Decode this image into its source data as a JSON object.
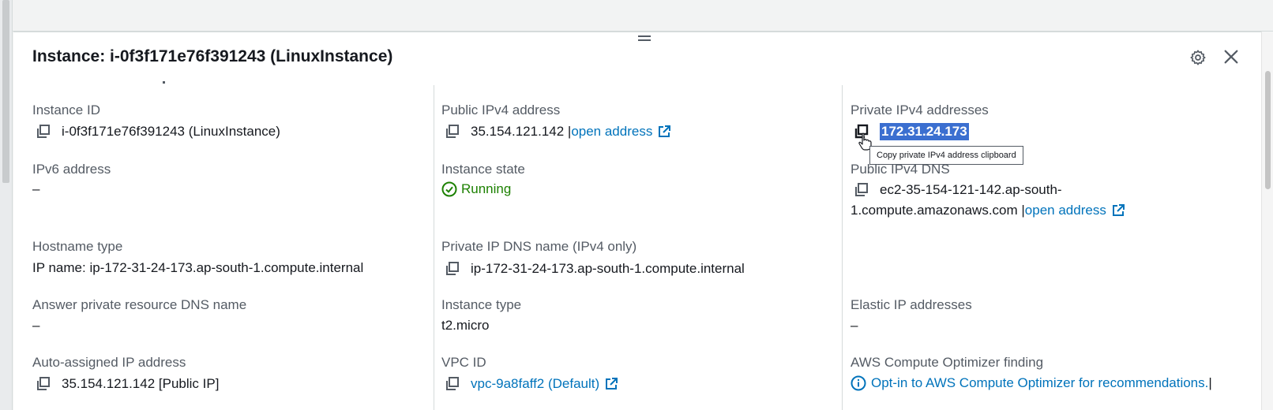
{
  "panel": {
    "title": "Instance: i-0f3f171e76f391243 (LinuxInstance)",
    "settings_icon": "gear-icon",
    "close_icon": "close-icon"
  },
  "tooltip": "Copy private IPv4 address clipboard",
  "fields": {
    "instance_id": {
      "label": "Instance ID",
      "value": "i-0f3f171e76f391243 (LinuxInstance)"
    },
    "public_ipv4": {
      "label": "Public IPv4 address",
      "value": "35.154.121.142 |",
      "link": "open address"
    },
    "private_ipv4": {
      "label": "Private IPv4 addresses",
      "value": "172.31.24.173"
    },
    "ipv6": {
      "label": "IPv6 address",
      "value": "–"
    },
    "instance_state": {
      "label": "Instance state",
      "value": "Running"
    },
    "public_dns": {
      "label": "Public IPv4 DNS",
      "value_line1": "ec2-35-154-121-142.ap-south-",
      "value_line2": "1.compute.amazonaws.com |",
      "link": "open address"
    },
    "hostname_type": {
      "label": "Hostname type",
      "value": "IP name: ip-172-31-24-173.ap-south-1.compute.internal"
    },
    "private_dns": {
      "label": "Private IP DNS name (IPv4 only)",
      "value": "ip-172-31-24-173.ap-south-1.compute.internal"
    },
    "answer_dns": {
      "label": "Answer private resource DNS name",
      "value": "–"
    },
    "instance_type": {
      "label": "Instance type",
      "value": "t2.micro"
    },
    "elastic_ip": {
      "label": "Elastic IP addresses",
      "value": "–"
    },
    "auto_ip": {
      "label": "Auto-assigned IP address",
      "value": "35.154.121.142 [Public IP]"
    },
    "vpc_id": {
      "label": "VPC ID",
      "value": "vpc-9a8faff2 (Default)"
    },
    "optimizer": {
      "label": "AWS Compute Optimizer finding",
      "value": "Opt-in to AWS Compute Optimizer for recommendations.",
      "suffix": " |"
    }
  },
  "colors": {
    "link": "#0073bb",
    "running": "#1d8102",
    "highlight": "#3b6fd0"
  }
}
